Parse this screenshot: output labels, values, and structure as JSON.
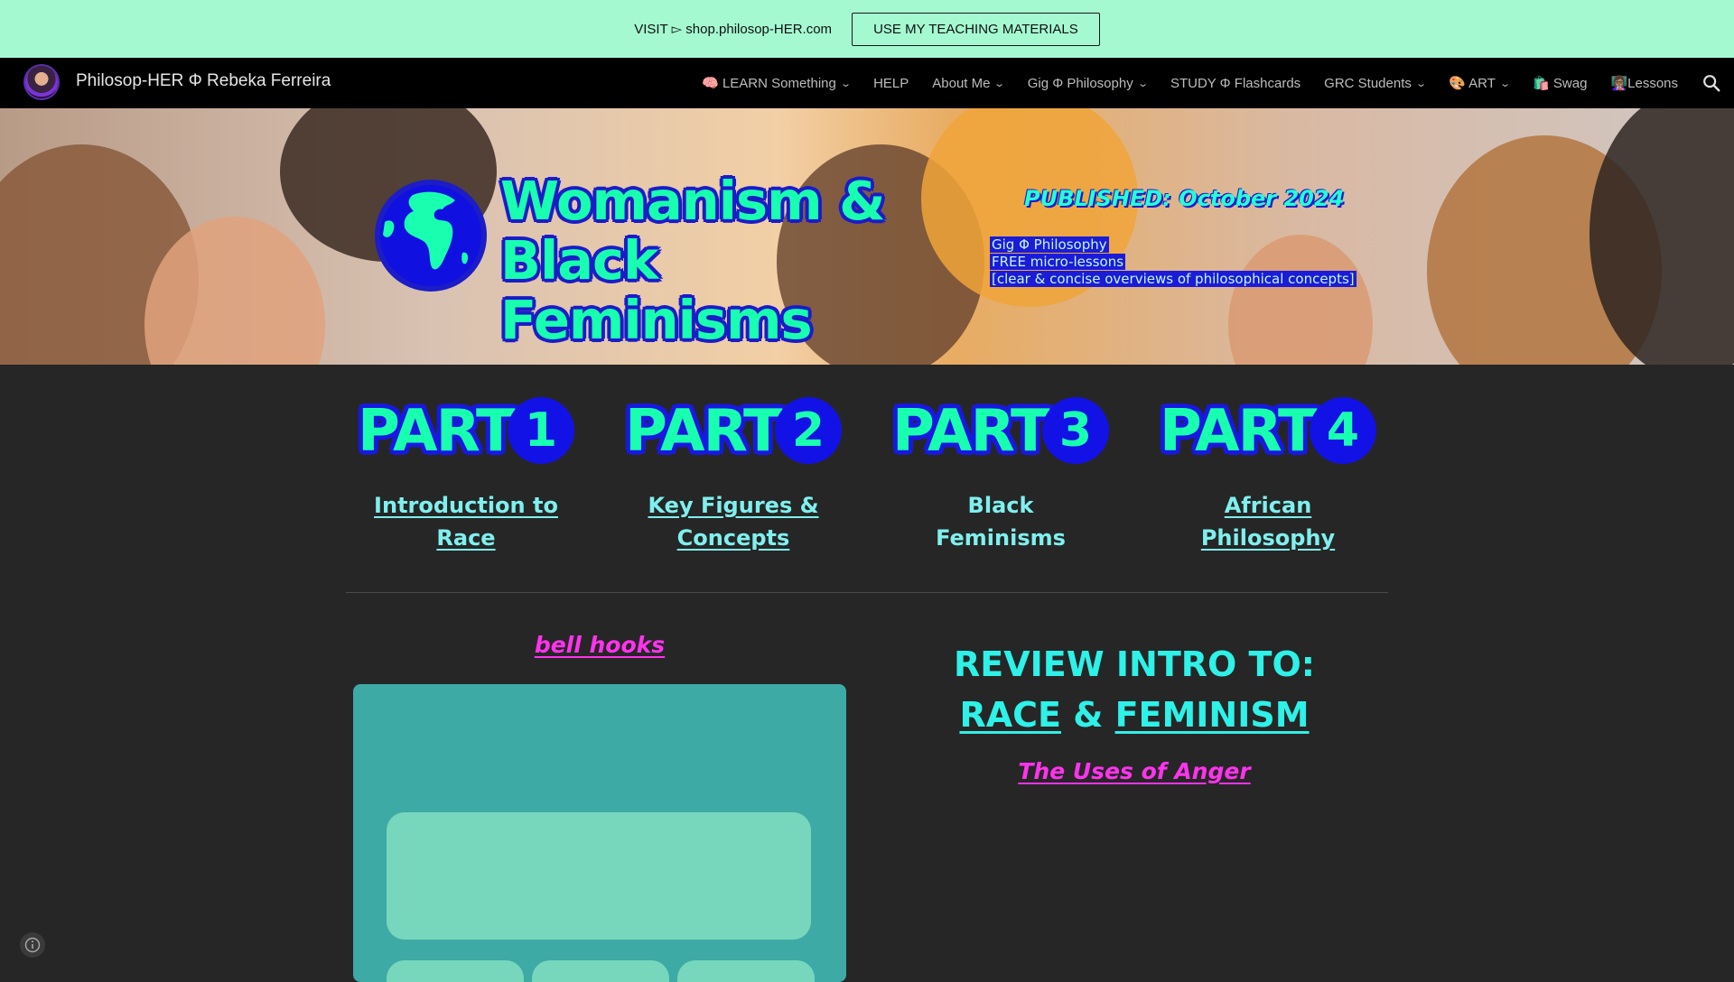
{
  "announcement": {
    "visit_text": "VISIT ▻ shop.philosop-HER.com",
    "button_label": "USE MY TEACHING MATERIALS"
  },
  "nav": {
    "site_title": "Philosop-HER Φ Rebeka Ferreira",
    "items": [
      {
        "label": "🧠 LEARN Something",
        "dropdown": true
      },
      {
        "label": "HELP",
        "dropdown": false
      },
      {
        "label": "About Me",
        "dropdown": true
      },
      {
        "label": "Gig Φ Philosophy",
        "dropdown": true
      },
      {
        "label": "STUDY Φ Flashcards",
        "dropdown": false
      },
      {
        "label": "GRC Students",
        "dropdown": true
      },
      {
        "label": "🎨 ART",
        "dropdown": true
      },
      {
        "label": "🛍️ Swag",
        "dropdown": false
      },
      {
        "label": "👩🏽‍🏫Lessons",
        "dropdown": false
      }
    ],
    "search_icon": "search-icon"
  },
  "hero": {
    "title_line1": "Womanism &",
    "title_line2": "Black Feminisms",
    "published": "PUBLISHED: October 2024",
    "meta_line1": "Gig Φ Philosophy",
    "meta_line2": "FREE micro-lessons",
    "meta_line3": "[clear & concise overviews of philosophical concepts]",
    "globe_icon": "globe-icon"
  },
  "parts": [
    {
      "word": "PART",
      "number": "1",
      "label": "Introduction to Race",
      "link": true
    },
    {
      "word": "PART",
      "number": "2",
      "label": "Key Figures & Concepts",
      "link": true
    },
    {
      "word": "PART",
      "number": "3",
      "label": "Black Feminisms",
      "link": false
    },
    {
      "word": "PART",
      "number": "4",
      "label": "African Philosophy",
      "link": true
    }
  ],
  "left_section": {
    "heading": "bell hooks"
  },
  "right_section": {
    "review_line1": "REVIEW INTRO TO:",
    "race_link": "RACE",
    "ampersand": "&",
    "feminism_link": "FEMINISM",
    "anger_link": "The Uses of Anger"
  },
  "colors": {
    "banner": "#a5f9d1",
    "nav": "#000000",
    "background": "#262626",
    "mint": "#19ffb0",
    "blue": "#1818e0",
    "magenta": "#ff33ee",
    "cyan": "#2ef1e8"
  }
}
